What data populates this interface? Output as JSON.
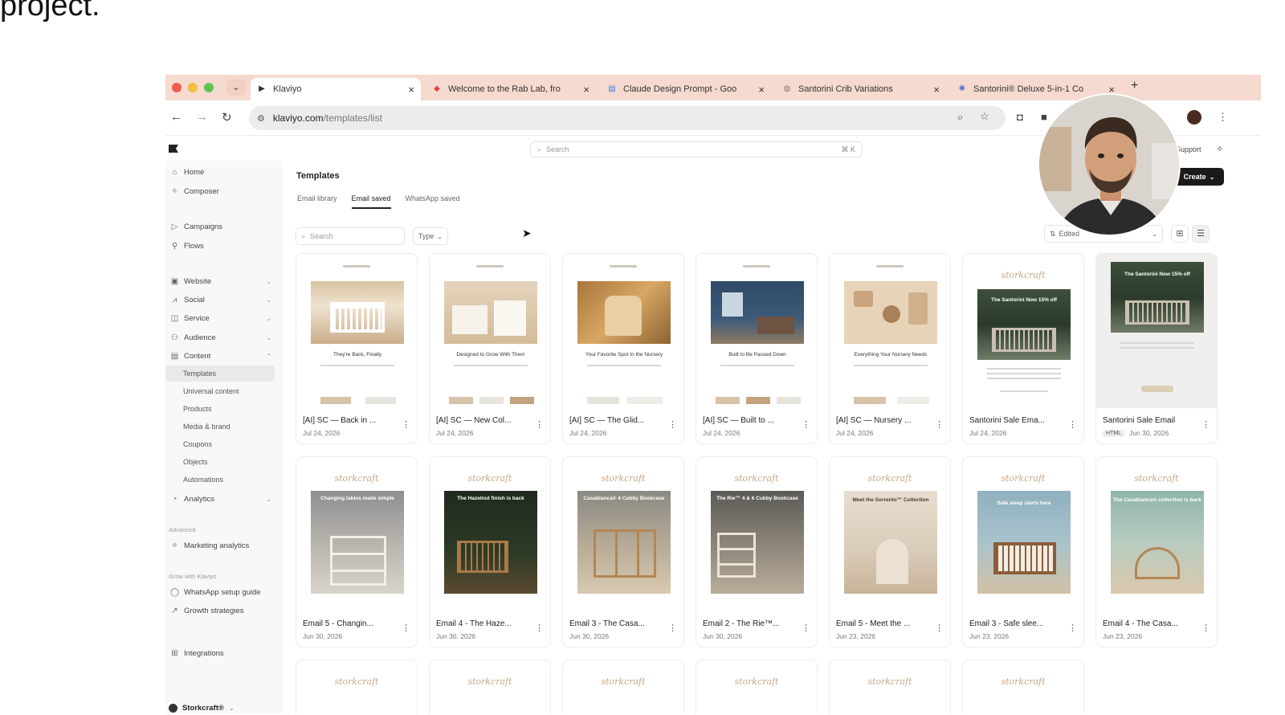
{
  "slide_text": "project.",
  "browser": {
    "tabs": [
      {
        "title": "Klaviyo",
        "favicon": "klaviyo-flag-icon"
      },
      {
        "title": "Welcome to the Rab Lab, fro",
        "favicon": "red-logo-icon"
      },
      {
        "title": "Claude Design Prompt - Goo",
        "favicon": "google-docs-icon"
      },
      {
        "title": "Santorini Crib Variations",
        "favicon": "globe-icon"
      },
      {
        "title": "Santorini® Deluxe 5-in-1 Co",
        "favicon": "chatgpt-icon"
      }
    ],
    "url_main": "klaviyo.com",
    "url_path": "/templates/list"
  },
  "app": {
    "search_placeholder": "Search",
    "search_shortcut": "⌘ K",
    "support_label": "Support",
    "create_label": "Create"
  },
  "sidebar": {
    "items": [
      {
        "label": "Home",
        "icon": "home-icon"
      },
      {
        "label": "Composer",
        "icon": "sparkle-icon"
      },
      {
        "label": "Campaigns",
        "icon": "send-icon"
      },
      {
        "label": "Flows",
        "icon": "flows-icon"
      },
      {
        "label": "Website",
        "icon": "website-icon"
      },
      {
        "label": "Social",
        "icon": "social-icon"
      },
      {
        "label": "Service",
        "icon": "service-icon"
      },
      {
        "label": "Audience",
        "icon": "audience-icon"
      },
      {
        "label": "Content",
        "icon": "content-icon"
      }
    ],
    "content_sub": [
      "Templates",
      "Universal content",
      "Products",
      "Media & brand",
      "Coupons",
      "Objects",
      "Automations"
    ],
    "analytics": "Analytics",
    "advanced_section": "Advanced",
    "marketing_analytics": "Marketing analytics",
    "grow_section": "Grow with Klaviyo",
    "whatsapp_guide": "WhatsApp setup guide",
    "growth_strategies": "Growth strategies",
    "integrations": "Integrations",
    "brand_account": "Storkcraft®"
  },
  "main": {
    "title": "Templates",
    "tabs": [
      "Email library",
      "Email saved",
      "WhatsApp saved"
    ],
    "filter_search_placeholder": "Search",
    "filter_type": "Type",
    "sort_label": "Edited"
  },
  "templates_row1": [
    {
      "name": "[AI] SC — Back in ...",
      "date": "Jul 24, 2026",
      "heading": "They're Back, Finally"
    },
    {
      "name": "[AI] SC — New Col...",
      "date": "Jul 24, 2026",
      "heading": "Designed to Grow With Them"
    },
    {
      "name": "[AI] SC — The Glid...",
      "date": "Jul 24, 2026",
      "heading": "Your Favorite Spot In the Nursery"
    },
    {
      "name": "[AI] SC — Built to ...",
      "date": "Jul 24, 2026",
      "heading": "Built to Be Passed Down"
    },
    {
      "name": "[AI] SC — Nursery ...",
      "date": "Jul 24, 2026",
      "heading": "Everything Your Nursery Needs"
    },
    {
      "name": "Santorini Sale Ema...",
      "date": "Jul 24, 2026",
      "heading": "The Santorini Now 15% off",
      "badge": ""
    },
    {
      "name": "Santorini Sale Email",
      "date": "Jun 30, 2026",
      "heading": "The Santorini Now 15% off",
      "badge": "HTML"
    }
  ],
  "templates_row2": [
    {
      "name": "Email 5 - Changin...",
      "date": "Jun 30, 2026",
      "heading": "Changing tables made simple"
    },
    {
      "name": "Email 4 - The Haze...",
      "date": "Jun 30, 2026",
      "heading": "The Hazelnut finish is back"
    },
    {
      "name": "Email 3 - The Casa...",
      "date": "Jun 30, 2026",
      "heading": "Casablanca® 4 Cubby Bookcase"
    },
    {
      "name": "Email 2 - The Rie™...",
      "date": "Jun 30, 2026",
      "heading": "The Rie™ 4 & 6 Cubby Bookcase"
    },
    {
      "name": "Email 5 - Meet the ...",
      "date": "Jun 23, 2026",
      "heading": "Meet the Sorrento™ Collection"
    },
    {
      "name": "Email 3 - Safe slee...",
      "date": "Jun 23, 2026",
      "heading": "Safe sleep starts here"
    },
    {
      "name": "Email 4 - The Casa...",
      "date": "Jun 23, 2026",
      "heading": "The Casablanca® collection is back"
    }
  ],
  "template_brand": "storkcraft",
  "colors": {
    "tab_strip": "#f6d9cf",
    "create_button": "#1a1a1a",
    "brand_logo": "#c6a98a"
  }
}
